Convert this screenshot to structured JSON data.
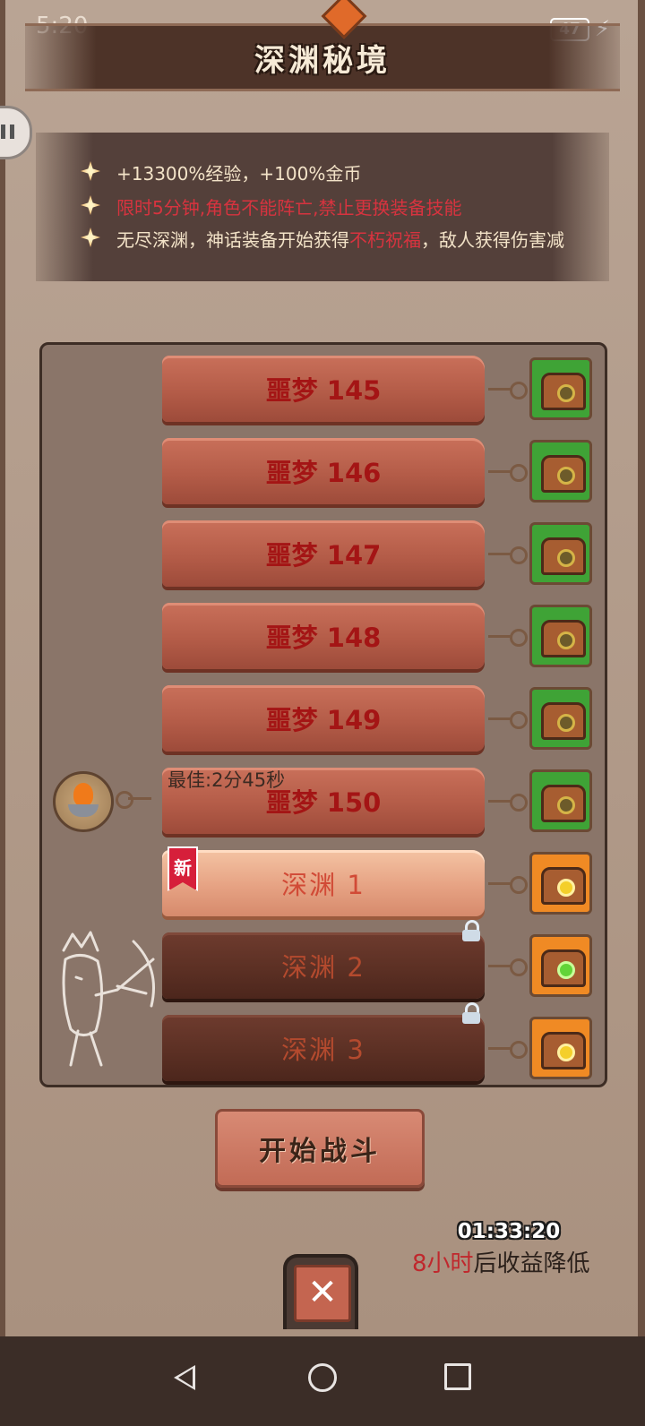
{
  "status": {
    "time": "5:20",
    "battery": "47"
  },
  "header": {
    "title": "深渊秘境"
  },
  "info": {
    "bonus": "+13300%经验，+100%金币",
    "rule": "限时5分钟,角色不能阵亡,禁止更换装备技能",
    "desc_start": "无尽深渊，神话装备开始获得",
    "desc_highlight": "不朽祝福",
    "desc_end": "，敌人获得伤害减"
  },
  "stages": [
    {
      "label": "噩梦 145",
      "state": "cleared",
      "chest": "green"
    },
    {
      "label": "噩梦 146",
      "state": "cleared",
      "chest": "green"
    },
    {
      "label": "噩梦 147",
      "state": "cleared",
      "chest": "green"
    },
    {
      "label": "噩梦 148",
      "state": "cleared",
      "chest": "green"
    },
    {
      "label": "噩梦 149",
      "state": "cleared",
      "chest": "green"
    },
    {
      "label": "噩梦 150",
      "state": "cleared",
      "chest": "green"
    },
    {
      "label": "深渊 1",
      "state": "new",
      "chest": "orange-gold"
    },
    {
      "label": "深渊 2",
      "state": "locked",
      "chest": "orange-gem"
    },
    {
      "label": "深渊 3",
      "state": "locked",
      "chest": "orange-gold"
    }
  ],
  "player": {
    "best_time": "最佳:2分45秒",
    "badge": "新"
  },
  "actions": {
    "start": "开始战斗",
    "close": "✕"
  },
  "reward_timer": {
    "time": "01:33:20",
    "hours": "8小时",
    "note_rest": "后收益降低"
  },
  "icons": [
    "pause-icon",
    "battery-icon",
    "charge-icon",
    "chest-icon",
    "padlock-icon",
    "close-icon",
    "back-icon",
    "home-icon",
    "recents-icon"
  ],
  "colors": {
    "nightmare_label": "#a41515",
    "bonus_text": "#f3e3c8",
    "rule_text": "#d7333f",
    "chest_green": "#3fa336",
    "chest_orange": "#f08a24",
    "start_button": "#c26b56"
  }
}
